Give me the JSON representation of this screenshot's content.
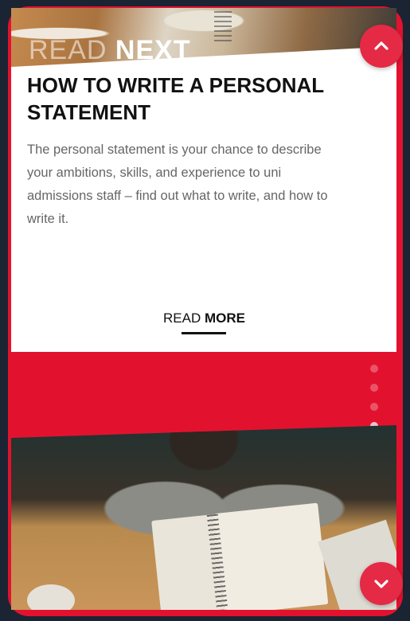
{
  "header": {
    "read_next_light": "READ",
    "read_next_bold": "NEXT"
  },
  "article": {
    "title": "HOW TO WRITE A PERSONAL STATEMENT",
    "description": "The personal statement is your chance to describe your ambitions, skills, and experience to uni admissions staff – find out what to write, and how to write it.",
    "read_more_light": "READ",
    "read_more_bold": "MORE"
  },
  "pagination": {
    "total": 5,
    "active_index": 4
  },
  "colors": {
    "accent": "#e2122f",
    "button": "#e42a44",
    "background": "#1b2433"
  },
  "icons": {
    "up": "chevron-up-icon",
    "down": "chevron-down-icon"
  }
}
